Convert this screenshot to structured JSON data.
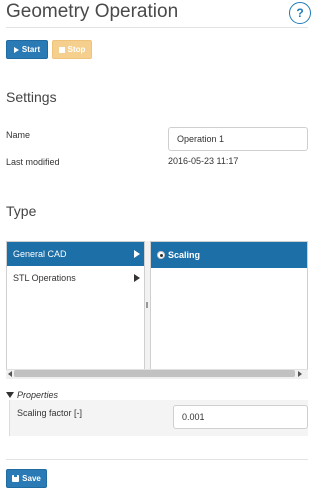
{
  "page": {
    "title": "Geometry Operation",
    "help_label": "?"
  },
  "toolbar": {
    "start_label": "Start",
    "stop_label": "Stop"
  },
  "settings": {
    "heading": "Settings",
    "name_label": "Name",
    "name_value": "Operation 1",
    "modified_label": "Last modified",
    "modified_value": "2016-05-23 11:17"
  },
  "type": {
    "heading": "Type",
    "categories": [
      {
        "label": "General CAD",
        "selected": true
      },
      {
        "label": "STL Operations",
        "selected": false
      }
    ],
    "options": [
      {
        "label": "Scaling",
        "selected": true
      }
    ]
  },
  "properties": {
    "heading": "Properties",
    "scaling_factor_label": "Scaling factor [-]",
    "scaling_factor_value": "0.001"
  },
  "footer": {
    "save_label": "Save"
  },
  "colors": {
    "primary": "#2a7ab5",
    "selected": "#1d6fa8",
    "stop_disabled": "#f5cf8e"
  }
}
